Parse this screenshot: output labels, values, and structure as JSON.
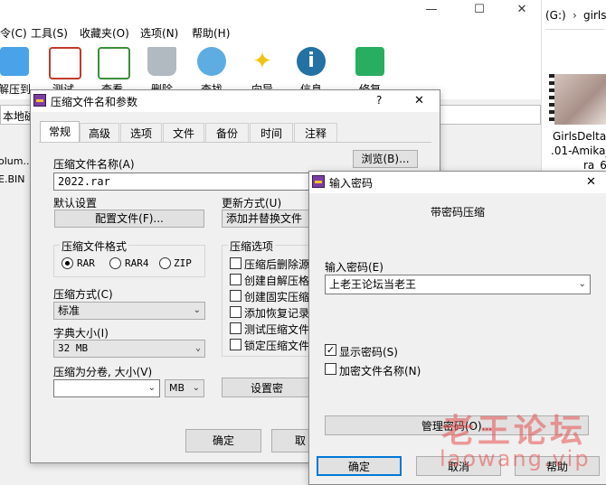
{
  "main_window": {
    "menu": [
      "令(C)",
      "工具(S)",
      "收藏夹(O)",
      "选项(N)",
      "帮助(H)"
    ],
    "toolbar": [
      {
        "label": "解压到",
        "icon": "extract-folder-icon",
        "color": "#2a8fd8"
      },
      {
        "label": "测试",
        "icon": "test-clipboard-icon",
        "color": "#c0392b"
      },
      {
        "label": "查看",
        "icon": "view-book-icon",
        "color": "#3a8f3a"
      },
      {
        "label": "删除",
        "icon": "trash-icon",
        "color": "#7f8c8d"
      },
      {
        "label": "查找",
        "icon": "magnifier-icon",
        "color": "#2e86c1"
      },
      {
        "label": "向导",
        "icon": "wizard-wand-icon",
        "color": "#f1c40f"
      },
      {
        "label": "信息",
        "icon": "info-icon",
        "color": "#2471a3"
      },
      {
        "label": "修复",
        "icon": "repair-icon",
        "color": "#27ae60"
      }
    ],
    "address": "本地磁",
    "left_files": [
      "olum..",
      "E.BIN"
    ]
  },
  "explorer": {
    "path_drive": "(G:)",
    "path_folder": "girls",
    "thumb_caption": [
      "GirlsDelta-",
      ".01-Amika_",
      "ra_6"
    ]
  },
  "archive_dialog": {
    "title": "压缩文件名和参数",
    "help": "?",
    "tabs": [
      "常规",
      "高级",
      "选项",
      "文件",
      "备份",
      "时间",
      "注释"
    ],
    "archive_name_label": "压缩文件名称(A)",
    "archive_name_value": "2022.rar",
    "browse_button": "浏览(B)...",
    "default_settings_label": "默认设置",
    "profiles_button": "配置文件(F)...",
    "update_mode_label": "更新方式(U)",
    "update_mode_value": "添加并替换文件",
    "format_group": "压缩文件格式",
    "formats": [
      "RAR",
      "RAR4",
      "ZIP"
    ],
    "selected_format": "RAR",
    "method_label": "压缩方式(C)",
    "method_value": "标准",
    "dict_label": "字典大小(I)",
    "dict_value": "32 MB",
    "split_label": "压缩为分卷, 大小(V)",
    "split_value": "",
    "split_unit": "MB",
    "options_group": "压缩选项",
    "options": [
      "压缩后删除源",
      "创建自解压格",
      "创建固实压缩",
      "添加恢复记录",
      "测试压缩文件",
      "锁定压缩文件"
    ],
    "set_password_button": "设置密",
    "ok_button": "确定",
    "cancel_button": "取"
  },
  "password_dialog": {
    "title": "输入密码",
    "heading": "带密码压缩",
    "password_label": "输入密码(E)",
    "password_value": "上老王论坛当老王",
    "show_password_label": "显示密码(S)",
    "show_password_checked": true,
    "encrypt_names_label": "加密文件名称(N)",
    "encrypt_names_checked": false,
    "manage_button": "管理密码(O)...",
    "ok_button": "确定",
    "cancel_button": "取消",
    "help_button": "帮助"
  },
  "watermark": {
    "line1": "老王论坛",
    "line2": "laowang.vip"
  }
}
